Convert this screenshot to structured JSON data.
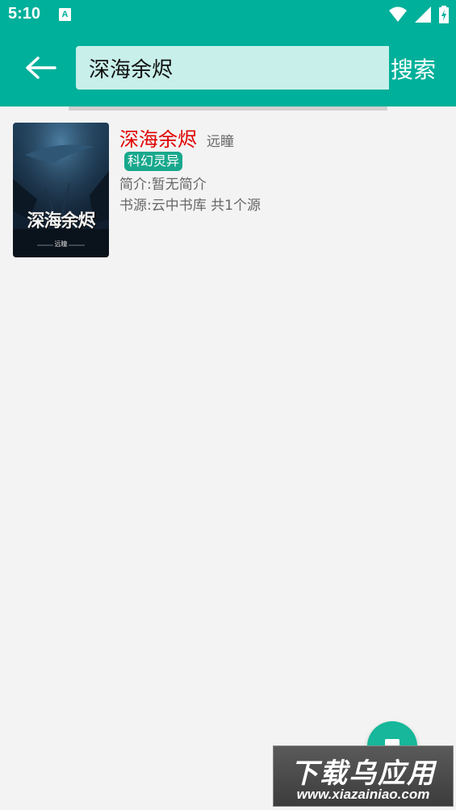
{
  "status_bar": {
    "time": "5:10",
    "notification_badge": "A",
    "icons": [
      "wifi-icon",
      "signal-icon",
      "battery-icon"
    ]
  },
  "toolbar": {
    "back_icon": "arrow-left-icon",
    "search_value": "深海余烬",
    "search_button_label": "搜索"
  },
  "results": [
    {
      "title": "深海余烬",
      "author": "远瞳",
      "tag": "科幻灵异",
      "intro": "简介:暂无简介",
      "source": "书源:云中书库 共1个源",
      "cover_text": "深海余烬",
      "cover_author": "远瞳"
    }
  ],
  "fab": {
    "icon": "stop-square-icon"
  },
  "watermark": {
    "main": "下载乌应用",
    "url": "www.xiazainiao.com"
  },
  "colors": {
    "primary": "#00b09a",
    "title_red": "#e00000",
    "tag_green": "#18a88c"
  }
}
